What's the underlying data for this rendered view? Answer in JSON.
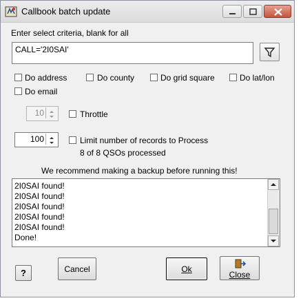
{
  "window": {
    "title": "Callbook batch update"
  },
  "criteria": {
    "label": "Enter select criteria, blank for all",
    "value": "CALL='2I0SAI'"
  },
  "options": {
    "do_address": "Do address",
    "do_county": "Do county",
    "do_grid_square": "Do grid square",
    "do_lat_lon": "Do lat/lon",
    "do_email": "Do email"
  },
  "throttle": {
    "value": "10",
    "label": "Throttle"
  },
  "limit": {
    "value": "100",
    "label": "Limit number of records to Process",
    "status": "8 of 8 QSOs processed"
  },
  "recommend": "We recommend making a backup before running this!",
  "log": {
    "lines": [
      "2I0SAI found!",
      "2I0SAI found!",
      "2I0SAI found!",
      "2I0SAI found!",
      "2I0SAI found!",
      "Done!"
    ]
  },
  "buttons": {
    "help": "?",
    "cancel": "Cancel",
    "ok": "Ok",
    "close": "Close"
  },
  "icons": {
    "app": "callbook-app-icon",
    "filter": "filter-funnel-icon",
    "help": "question-mark-icon",
    "close": "exit-door-icon"
  },
  "colors": {
    "title_close_button": "#c4553f",
    "window_bg": "#f0f0f0"
  }
}
